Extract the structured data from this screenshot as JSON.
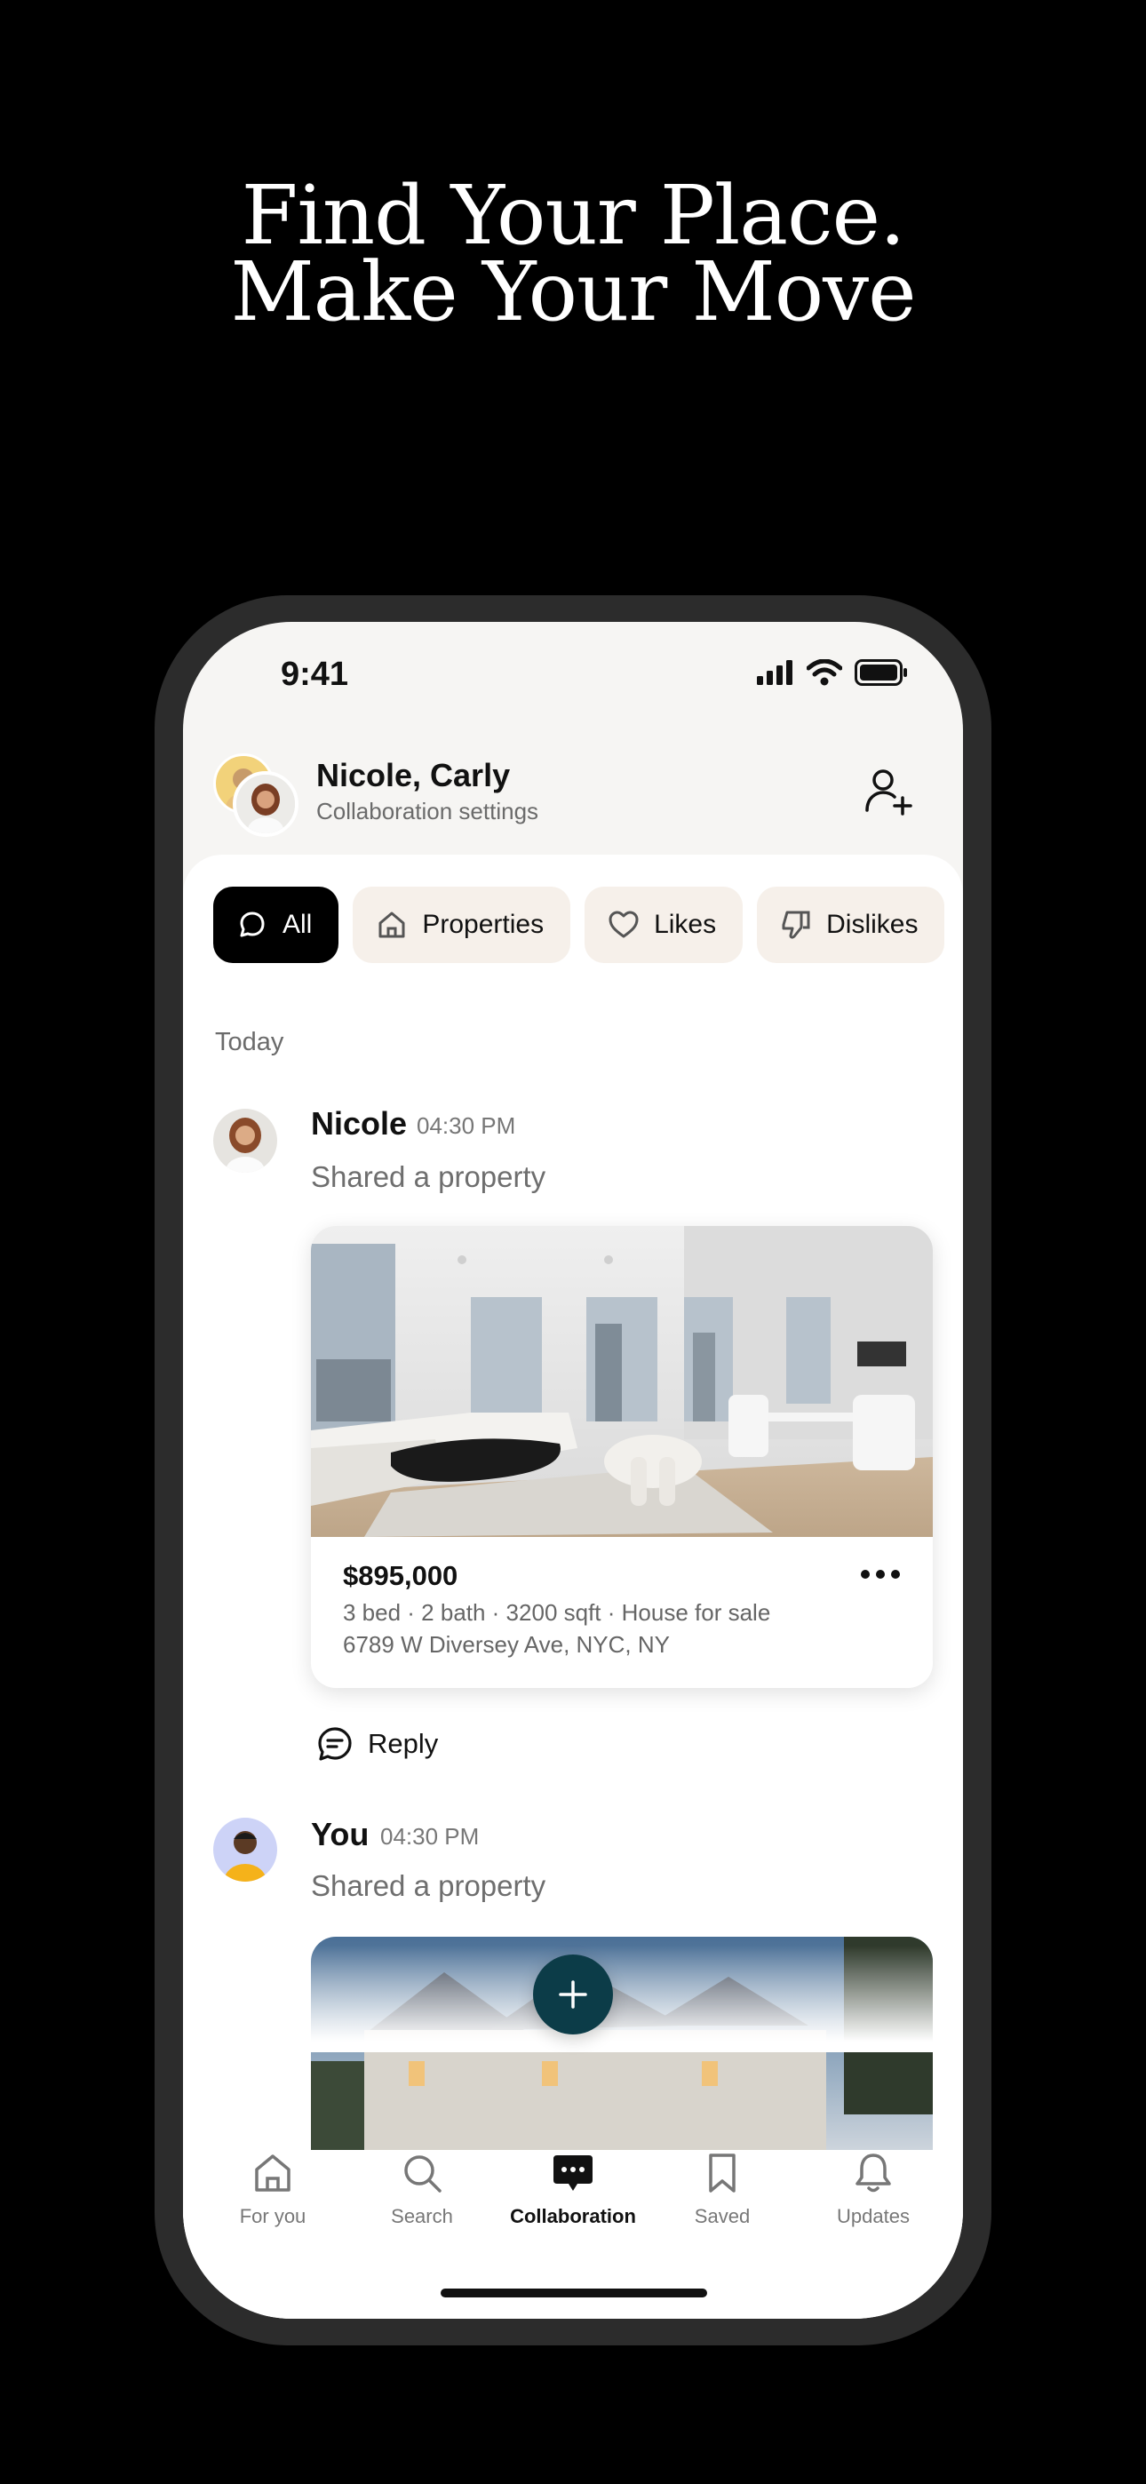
{
  "marketing": {
    "headline_line1": "Find Your Place.",
    "headline_line2": "Make Your Move"
  },
  "status_bar": {
    "time": "9:41"
  },
  "header": {
    "title": "Nicole, Carly",
    "subtitle": "Collaboration settings"
  },
  "filters": [
    {
      "label": "All",
      "icon": "chat-icon",
      "active": true
    },
    {
      "label": "Properties",
      "icon": "home-icon",
      "active": false
    },
    {
      "label": "Likes",
      "icon": "heart-icon",
      "active": false
    },
    {
      "label": "Dislikes",
      "icon": "thumbs-down-icon",
      "active": false
    }
  ],
  "feed": {
    "day_label": "Today",
    "messages": [
      {
        "author": "Nicole",
        "time": "04:30 PM",
        "text": "Shared a property",
        "property": {
          "price": "$895,000",
          "details": "3 bed · 2 bath · 3200 sqft · House for sale",
          "address": "6789 W Diversey Ave, NYC, NY"
        },
        "reply_label": "Reply"
      },
      {
        "author": "You",
        "time": "04:30 PM",
        "text": "Shared a property"
      }
    ]
  },
  "tabs": [
    {
      "label": "For you",
      "icon": "home-icon",
      "active": false
    },
    {
      "label": "Search",
      "icon": "search-icon",
      "active": false
    },
    {
      "label": "Collaboration",
      "icon": "chat-bubble-icon",
      "active": true
    },
    {
      "label": "Saved",
      "icon": "bookmark-icon",
      "active": false
    },
    {
      "label": "Updates",
      "icon": "bell-icon",
      "active": false
    }
  ],
  "colors": {
    "fab": "#0c3c48",
    "chip_bg": "#f6f0ea",
    "chip_active_bg": "#000000"
  }
}
